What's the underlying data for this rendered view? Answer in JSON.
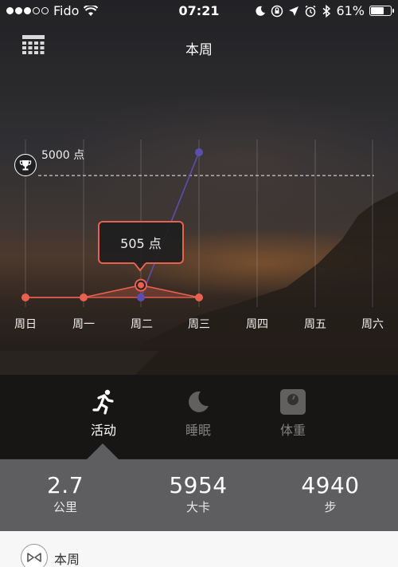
{
  "status_bar": {
    "carrier": "Fido",
    "time": "07:21",
    "battery": "61%",
    "signal_filled": 3,
    "signal_total": 5
  },
  "header": {
    "title": "本周",
    "calendar_icon": "calendar-grid-icon"
  },
  "chart_data": {
    "type": "line",
    "categories": [
      "周日",
      "周一",
      "周二",
      "周三",
      "周四",
      "周五",
      "周六"
    ],
    "goal_label": "5000 点",
    "goal": 5000,
    "series": [
      {
        "values": [
          0,
          0,
          505,
          0,
          null,
          null,
          null
        ],
        "color": "#e86150"
      },
      {
        "values": [
          null,
          null,
          0,
          5954,
          null,
          null,
          null
        ],
        "color": "#5a4fb0"
      }
    ],
    "selected": {
      "index": 2,
      "label": "505 点"
    },
    "ylim": [
      0,
      5954
    ],
    "grid": true
  },
  "tabs": [
    {
      "label": "活动",
      "icon": "running-person-icon",
      "active": true
    },
    {
      "label": "睡眠",
      "icon": "moon-icon",
      "active": false
    },
    {
      "label": "体重",
      "icon": "scale-icon",
      "active": false
    }
  ],
  "stats": [
    {
      "value": "2.7",
      "unit": "公里"
    },
    {
      "value": "5954",
      "unit": "大卡"
    },
    {
      "value": "4940",
      "unit": "步"
    }
  ],
  "bottom": {
    "label": "本周",
    "icon": "bowtie-icon"
  },
  "colors": {
    "accent_red": "#e86150",
    "accent_purple": "#5a4fb0",
    "panel_gray": "#5e5d60"
  }
}
